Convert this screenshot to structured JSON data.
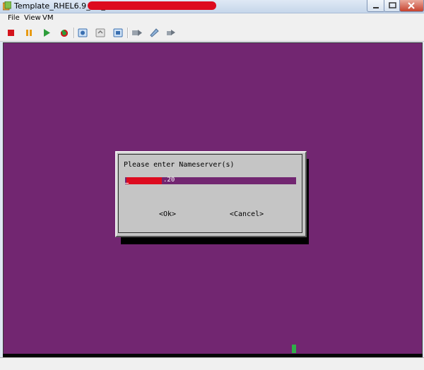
{
  "window": {
    "title": "Template_RHEL6.9_OS_x64"
  },
  "menu": {
    "items": [
      "File",
      "View",
      "VM"
    ]
  },
  "toolbar": {
    "icons": [
      "stop-icon",
      "pause-icon",
      "play-icon",
      "reset-icon",
      "snapshot-icon",
      "revert-snapshot-icon",
      "snapshot-manager-icon",
      "send-ctrl-alt-del-icon",
      "edit-settings-icon",
      "connect-devices-icon"
    ]
  },
  "dialog": {
    "prompt": "Please enter Nameserver(s)",
    "nameserver_value_visible": ".20",
    "ok_label": "<Ok>",
    "cancel_label": "<Cancel>"
  },
  "colors": {
    "console_bg": "#722671",
    "dialog_bg": "#c5c5c5",
    "redaction": "#dd0b1f",
    "status_indicator": "#2fae48"
  }
}
